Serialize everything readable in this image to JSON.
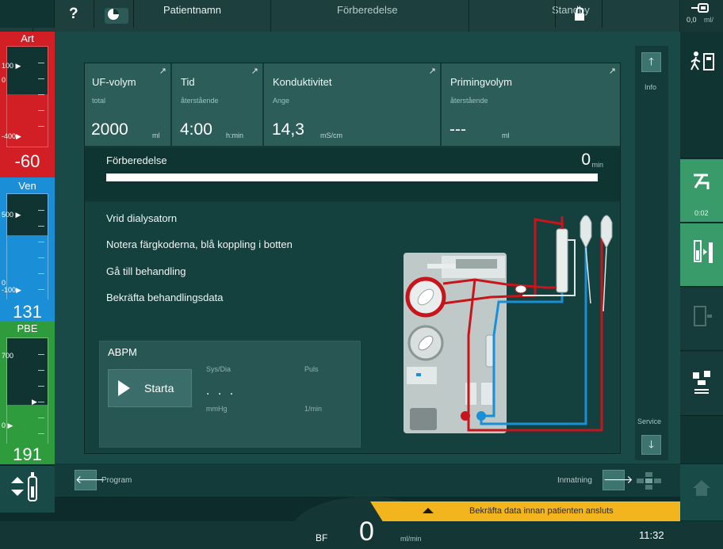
{
  "topbar": {
    "pressure_unit": "mmHg",
    "tab_patient": "Patientnamn",
    "tab_phase": "Förberedelse",
    "tab_status": "Standby",
    "uf_rate_value": "0,0",
    "uf_rate_unit": "ml/"
  },
  "pressures": {
    "art": {
      "title": "Art",
      "max_label": "100",
      "zero_label": "0",
      "min_label": "-400",
      "reading": "-60",
      "color": "#d21f26"
    },
    "ven": {
      "title": "Ven",
      "max_label": "500",
      "zero_label": "0",
      "min_label": "-100",
      "reading": "131",
      "color": "#1a8fd8"
    },
    "pbe": {
      "title": "PBE",
      "max_label": "700",
      "zero_label": "0",
      "reading": "191",
      "color": "#2e9c3c"
    }
  },
  "tiles": [
    {
      "name": "UF-volym",
      "sub": "total",
      "value": "2000",
      "unit": "ml"
    },
    {
      "name": "Tid",
      "sub": "återstående",
      "value": "4:00",
      "unit": "h:min"
    },
    {
      "name": "Konduktivitet",
      "sub": "Ange",
      "value": "14,3",
      "unit": "mS/cm"
    },
    {
      "name": "Primingvolym",
      "sub": "återstående",
      "value": "---",
      "unit": "ml"
    }
  ],
  "preparation": {
    "label": "Förberedelse",
    "value": "0",
    "unit": "min",
    "progress": 1.0
  },
  "steps": [
    "Vrid dialysatorn",
    "Notera färgkoderna, blå koppling i botten",
    "Gå till behandling",
    "Bekräfta behandlingsdata"
  ],
  "abpm": {
    "title": "ABPM",
    "start_label": "Starta",
    "sys_dia_label": "Sys/Dia",
    "pulse_label": "Puls",
    "value": ". . .",
    "unit_mmhg": "mmHg",
    "unit_pulse": "1/min"
  },
  "side": {
    "info_label": "Info",
    "service_label": "Service",
    "timer": "0:02"
  },
  "nav": {
    "program_label": "Program",
    "input_label": "Inmatning"
  },
  "alarm": {
    "text": "Bekräfta data innan patienten ansluts",
    "color": "#f2b51d"
  },
  "statusbar": {
    "bf_label": "BF",
    "bf_value": "0",
    "bf_unit": "ml/min",
    "time": "11:32"
  }
}
